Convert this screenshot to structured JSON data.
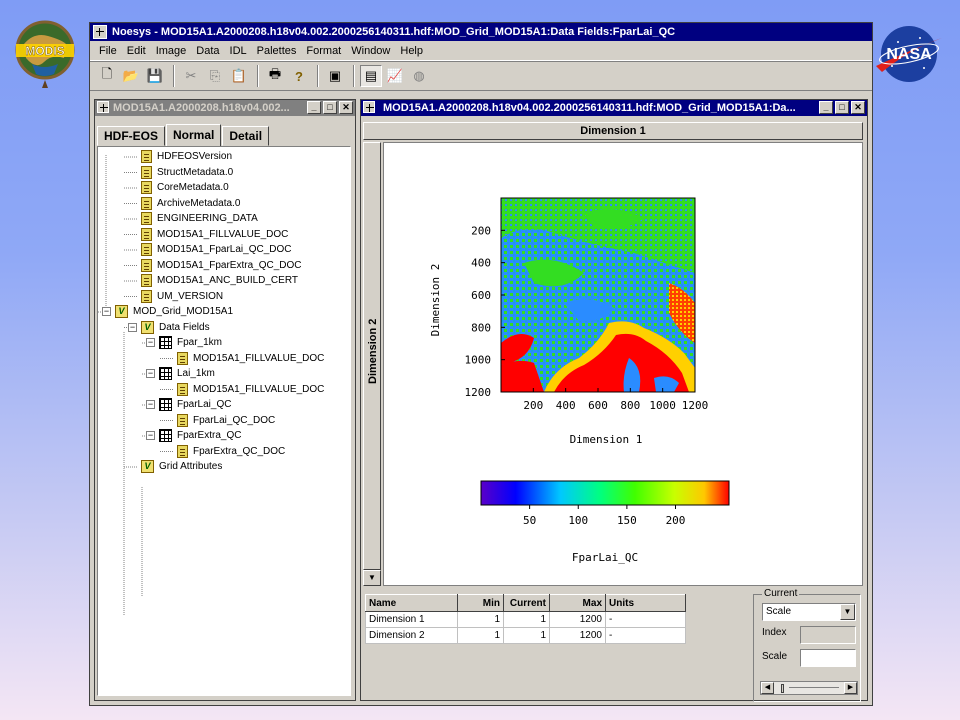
{
  "app": {
    "title": "Noesys - MOD15A1.A2000208.h18v04.002.2000256140311.hdf:MOD_Grid_MOD15A1:Data Fields:FparLai_QC",
    "menus": [
      "File",
      "Edit",
      "Image",
      "Data",
      "IDL",
      "Palettes",
      "Format",
      "Window",
      "Help"
    ],
    "toolbar_icons": [
      "new-file-icon",
      "open-folder-icon",
      "save-icon",
      "cut-icon",
      "copy-icon",
      "paste-icon",
      "print-icon",
      "help-icon",
      "frame-icon",
      "image-view-icon",
      "chart-icon",
      "globe-icon"
    ]
  },
  "tree_window": {
    "title": "MOD15A1.A2000208.h18v04.002...",
    "tabs": [
      "HDF-EOS",
      "Normal",
      "Detail"
    ],
    "active_tab": "Normal",
    "nodes": [
      {
        "label": "HDFEOSVersion",
        "icon": "doc",
        "depth": 1
      },
      {
        "label": "StructMetadata.0",
        "icon": "doc",
        "depth": 1
      },
      {
        "label": "CoreMetadata.0",
        "icon": "doc",
        "depth": 1
      },
      {
        "label": "ArchiveMetadata.0",
        "icon": "doc",
        "depth": 1
      },
      {
        "label": "ENGINEERING_DATA",
        "icon": "doc",
        "depth": 1
      },
      {
        "label": "MOD15A1_FILLVALUE_DOC",
        "icon": "doc",
        "depth": 1
      },
      {
        "label": "MOD15A1_FparLai_QC_DOC",
        "icon": "doc",
        "depth": 1
      },
      {
        "label": "MOD15A1_FparExtra_QC_DOC",
        "icon": "doc",
        "depth": 1
      },
      {
        "label": "MOD15A1_ANC_BUILD_CERT",
        "icon": "doc",
        "depth": 1
      },
      {
        "label": "UM_VERSION",
        "icon": "doc",
        "depth": 1
      },
      {
        "label": "MOD_Grid_MOD15A1",
        "icon": "v",
        "depth": 0,
        "expand": "−"
      },
      {
        "label": "Data Fields",
        "icon": "v",
        "depth": 1,
        "expand": "−"
      },
      {
        "label": "Fpar_1km",
        "icon": "grid",
        "depth": 2,
        "expand": "−"
      },
      {
        "label": "MOD15A1_FILLVALUE_DOC",
        "icon": "doc",
        "depth": 3
      },
      {
        "label": "Lai_1km",
        "icon": "grid",
        "depth": 2,
        "expand": "−"
      },
      {
        "label": "MOD15A1_FILLVALUE_DOC",
        "icon": "doc",
        "depth": 3
      },
      {
        "label": "FparLai_QC",
        "icon": "grid",
        "depth": 2,
        "expand": "−"
      },
      {
        "label": "FparLai_QC_DOC",
        "icon": "doc",
        "depth": 3
      },
      {
        "label": "FparExtra_QC",
        "icon": "grid",
        "depth": 2,
        "expand": "−"
      },
      {
        "label": "FparExtra_QC_DOC",
        "icon": "doc",
        "depth": 3
      },
      {
        "label": "Grid Attributes",
        "icon": "v",
        "depth": 1
      }
    ]
  },
  "data_window": {
    "title": "MOD15A1.A2000208.h18v04.002.2000256140311.hdf:MOD_Grid_MOD15A1:Da...",
    "header_dim": "Dimension 1",
    "side_dim": "Dimension 2"
  },
  "chart_data": {
    "type": "heatmap",
    "xlabel": "Dimension 1",
    "ylabel": "Dimension 2",
    "xticks": [
      200,
      400,
      600,
      800,
      1000,
      1200
    ],
    "yticks": [
      200,
      400,
      600,
      800,
      1000,
      1200
    ],
    "xlim": [
      0,
      1200
    ],
    "ylim": [
      0,
      1200
    ],
    "colorbar": {
      "label": "FparLai_QC",
      "ticks": [
        50,
        100,
        150,
        200
      ],
      "range": [
        0,
        255
      ],
      "colormap": [
        "#5a00c8",
        "#0000ff",
        "#00c8ff",
        "#00ff80",
        "#40ff00",
        "#c8ff00",
        "#ffc800",
        "#ff0000"
      ]
    },
    "field_colors": {
      "land_high": "#ff0000",
      "vegetation": "#33dd22",
      "water": "#2a8cff",
      "mixed": "#ffd000",
      "cloud": "#1aa0e0"
    }
  },
  "dim_table": {
    "headers": [
      "Name",
      "Min",
      "Current",
      "Max",
      "Units"
    ],
    "rows": [
      [
        "Dimension 1",
        "1",
        "1",
        "1200",
        "-"
      ],
      [
        "Dimension 2",
        "1",
        "1",
        "1200",
        "-"
      ]
    ]
  },
  "current_panel": {
    "legend": "Current",
    "mode": "Scale",
    "index_label": "Index",
    "scale_label": "Scale"
  }
}
